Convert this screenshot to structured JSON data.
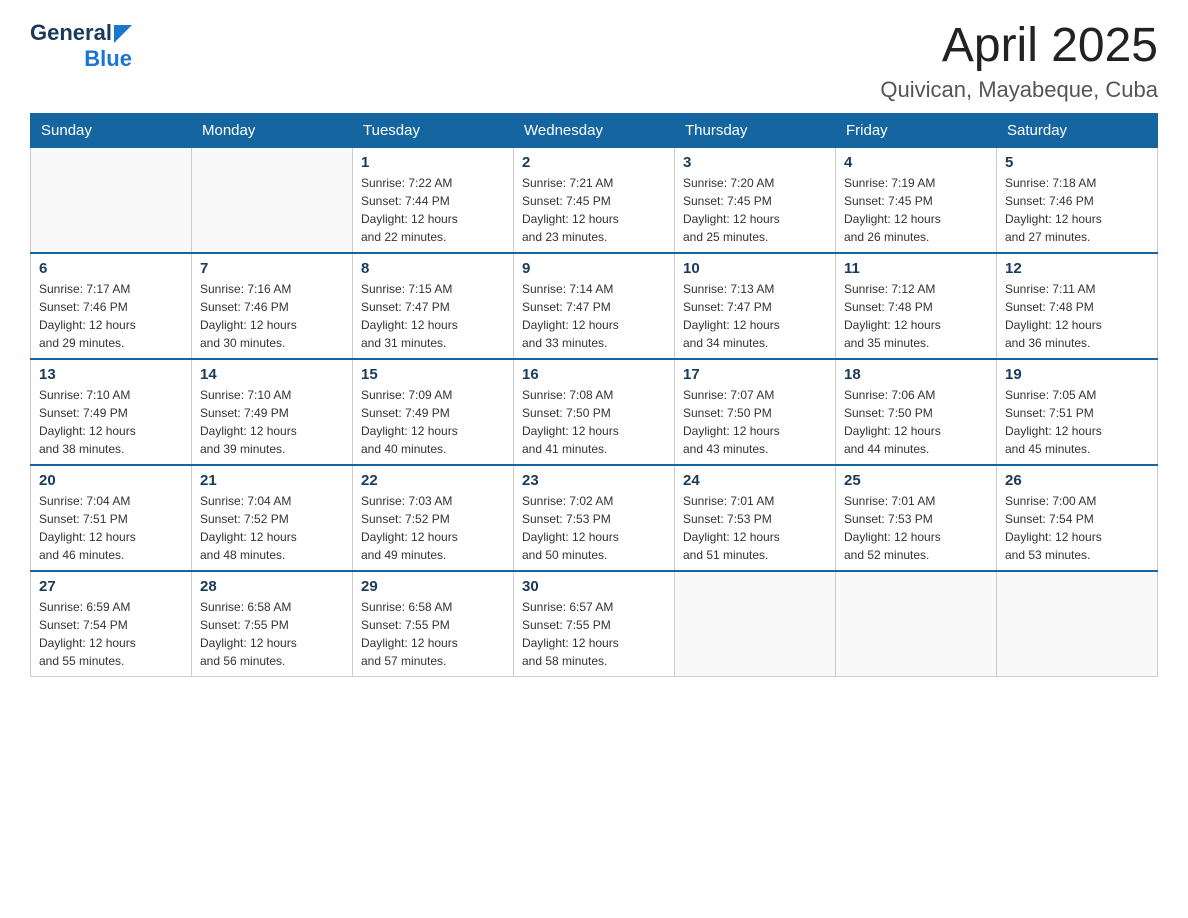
{
  "header": {
    "logo_general": "General",
    "logo_blue": "Blue",
    "month_year": "April 2025",
    "location": "Quivican, Mayabeque, Cuba"
  },
  "calendar": {
    "days_of_week": [
      "Sunday",
      "Monday",
      "Tuesday",
      "Wednesday",
      "Thursday",
      "Friday",
      "Saturday"
    ],
    "weeks": [
      [
        {
          "day": "",
          "info": ""
        },
        {
          "day": "",
          "info": ""
        },
        {
          "day": "1",
          "info": "Sunrise: 7:22 AM\nSunset: 7:44 PM\nDaylight: 12 hours\nand 22 minutes."
        },
        {
          "day": "2",
          "info": "Sunrise: 7:21 AM\nSunset: 7:45 PM\nDaylight: 12 hours\nand 23 minutes."
        },
        {
          "day": "3",
          "info": "Sunrise: 7:20 AM\nSunset: 7:45 PM\nDaylight: 12 hours\nand 25 minutes."
        },
        {
          "day": "4",
          "info": "Sunrise: 7:19 AM\nSunset: 7:45 PM\nDaylight: 12 hours\nand 26 minutes."
        },
        {
          "day": "5",
          "info": "Sunrise: 7:18 AM\nSunset: 7:46 PM\nDaylight: 12 hours\nand 27 minutes."
        }
      ],
      [
        {
          "day": "6",
          "info": "Sunrise: 7:17 AM\nSunset: 7:46 PM\nDaylight: 12 hours\nand 29 minutes."
        },
        {
          "day": "7",
          "info": "Sunrise: 7:16 AM\nSunset: 7:46 PM\nDaylight: 12 hours\nand 30 minutes."
        },
        {
          "day": "8",
          "info": "Sunrise: 7:15 AM\nSunset: 7:47 PM\nDaylight: 12 hours\nand 31 minutes."
        },
        {
          "day": "9",
          "info": "Sunrise: 7:14 AM\nSunset: 7:47 PM\nDaylight: 12 hours\nand 33 minutes."
        },
        {
          "day": "10",
          "info": "Sunrise: 7:13 AM\nSunset: 7:47 PM\nDaylight: 12 hours\nand 34 minutes."
        },
        {
          "day": "11",
          "info": "Sunrise: 7:12 AM\nSunset: 7:48 PM\nDaylight: 12 hours\nand 35 minutes."
        },
        {
          "day": "12",
          "info": "Sunrise: 7:11 AM\nSunset: 7:48 PM\nDaylight: 12 hours\nand 36 minutes."
        }
      ],
      [
        {
          "day": "13",
          "info": "Sunrise: 7:10 AM\nSunset: 7:49 PM\nDaylight: 12 hours\nand 38 minutes."
        },
        {
          "day": "14",
          "info": "Sunrise: 7:10 AM\nSunset: 7:49 PM\nDaylight: 12 hours\nand 39 minutes."
        },
        {
          "day": "15",
          "info": "Sunrise: 7:09 AM\nSunset: 7:49 PM\nDaylight: 12 hours\nand 40 minutes."
        },
        {
          "day": "16",
          "info": "Sunrise: 7:08 AM\nSunset: 7:50 PM\nDaylight: 12 hours\nand 41 minutes."
        },
        {
          "day": "17",
          "info": "Sunrise: 7:07 AM\nSunset: 7:50 PM\nDaylight: 12 hours\nand 43 minutes."
        },
        {
          "day": "18",
          "info": "Sunrise: 7:06 AM\nSunset: 7:50 PM\nDaylight: 12 hours\nand 44 minutes."
        },
        {
          "day": "19",
          "info": "Sunrise: 7:05 AM\nSunset: 7:51 PM\nDaylight: 12 hours\nand 45 minutes."
        }
      ],
      [
        {
          "day": "20",
          "info": "Sunrise: 7:04 AM\nSunset: 7:51 PM\nDaylight: 12 hours\nand 46 minutes."
        },
        {
          "day": "21",
          "info": "Sunrise: 7:04 AM\nSunset: 7:52 PM\nDaylight: 12 hours\nand 48 minutes."
        },
        {
          "day": "22",
          "info": "Sunrise: 7:03 AM\nSunset: 7:52 PM\nDaylight: 12 hours\nand 49 minutes."
        },
        {
          "day": "23",
          "info": "Sunrise: 7:02 AM\nSunset: 7:53 PM\nDaylight: 12 hours\nand 50 minutes."
        },
        {
          "day": "24",
          "info": "Sunrise: 7:01 AM\nSunset: 7:53 PM\nDaylight: 12 hours\nand 51 minutes."
        },
        {
          "day": "25",
          "info": "Sunrise: 7:01 AM\nSunset: 7:53 PM\nDaylight: 12 hours\nand 52 minutes."
        },
        {
          "day": "26",
          "info": "Sunrise: 7:00 AM\nSunset: 7:54 PM\nDaylight: 12 hours\nand 53 minutes."
        }
      ],
      [
        {
          "day": "27",
          "info": "Sunrise: 6:59 AM\nSunset: 7:54 PM\nDaylight: 12 hours\nand 55 minutes."
        },
        {
          "day": "28",
          "info": "Sunrise: 6:58 AM\nSunset: 7:55 PM\nDaylight: 12 hours\nand 56 minutes."
        },
        {
          "day": "29",
          "info": "Sunrise: 6:58 AM\nSunset: 7:55 PM\nDaylight: 12 hours\nand 57 minutes."
        },
        {
          "day": "30",
          "info": "Sunrise: 6:57 AM\nSunset: 7:55 PM\nDaylight: 12 hours\nand 58 minutes."
        },
        {
          "day": "",
          "info": ""
        },
        {
          "day": "",
          "info": ""
        },
        {
          "day": "",
          "info": ""
        }
      ]
    ]
  }
}
